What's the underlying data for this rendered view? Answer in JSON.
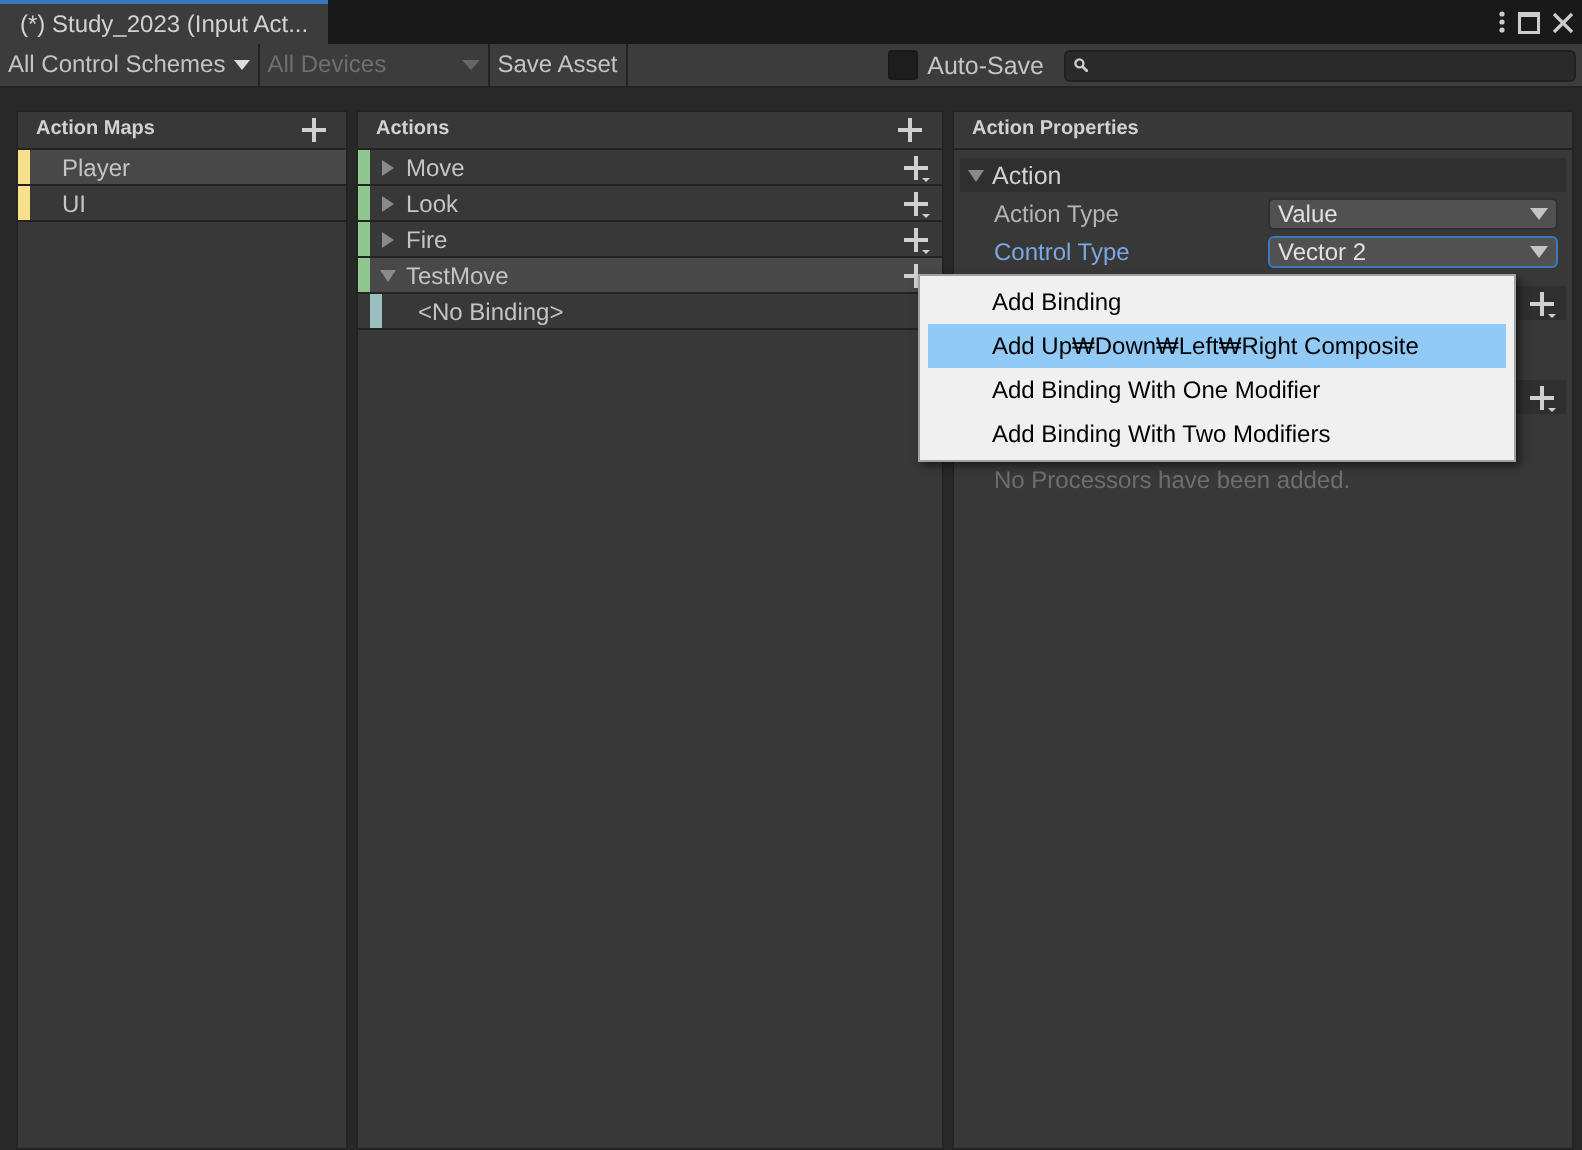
{
  "window": {
    "tab_title": "(*) Study_2023 (Input Act..."
  },
  "toolbar": {
    "control_scheme": "All Control Schemes",
    "devices": {
      "label": "All Devices",
      "disabled": true
    },
    "save": "Save Asset",
    "auto_save": {
      "label": "Auto-Save",
      "checked": false
    }
  },
  "action_maps": {
    "title": "Action Maps",
    "items": [
      {
        "label": "Player",
        "selected": true
      },
      {
        "label": "UI",
        "selected": false
      }
    ]
  },
  "actions": {
    "title": "Actions",
    "items": [
      {
        "label": "Move",
        "expanded": false,
        "selected": false
      },
      {
        "label": "Look",
        "expanded": false,
        "selected": false
      },
      {
        "label": "Fire",
        "expanded": false,
        "selected": false
      },
      {
        "label": "TestMove",
        "expanded": true,
        "selected": true,
        "children": [
          {
            "label": "<No Binding>"
          }
        ]
      }
    ]
  },
  "properties": {
    "title": "Action Properties",
    "section": {
      "label": "Action",
      "expanded": true
    },
    "fields": [
      {
        "label": "Action Type",
        "value": "Value",
        "focused": false
      },
      {
        "label": "Control Type",
        "value": "Vector 2",
        "focused": true
      }
    ],
    "processors_note": "No Processors have been added."
  },
  "menu": {
    "items": [
      {
        "label": "Add Binding",
        "selected": false
      },
      {
        "label": "Add Up₩Down₩Left₩Right Composite",
        "selected": true
      },
      {
        "label": "Add Binding With One Modifier",
        "selected": false
      },
      {
        "label": "Add Binding With Two Modifiers",
        "selected": false
      }
    ]
  }
}
